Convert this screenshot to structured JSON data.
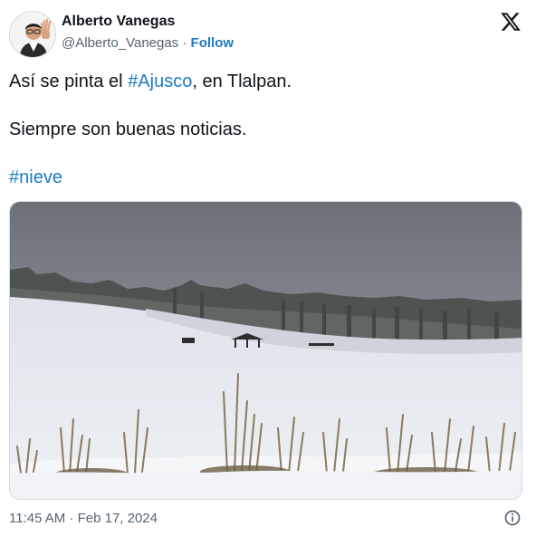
{
  "author": {
    "display_name": "Alberto Vanegas",
    "handle": "@Alberto_Vanegas",
    "separator": " · ",
    "follow_label": "Follow"
  },
  "tweet": {
    "line1_before": "Así se pinta el ",
    "line1_hashtag": "#Ajusco",
    "line1_after": ", en Tlalpan.",
    "line2": "Siempre son buenas noticias.",
    "line3_hashtag": "#nieve"
  },
  "footer": {
    "timestamp": "11:45 AM · Feb 17, 2024"
  },
  "icons": {
    "x_logo": "x-logo-icon",
    "info": "info-icon",
    "avatar": "avatar"
  },
  "colors": {
    "link": "#1d7bc4",
    "text": "#0f1419",
    "muted": "#536471"
  }
}
